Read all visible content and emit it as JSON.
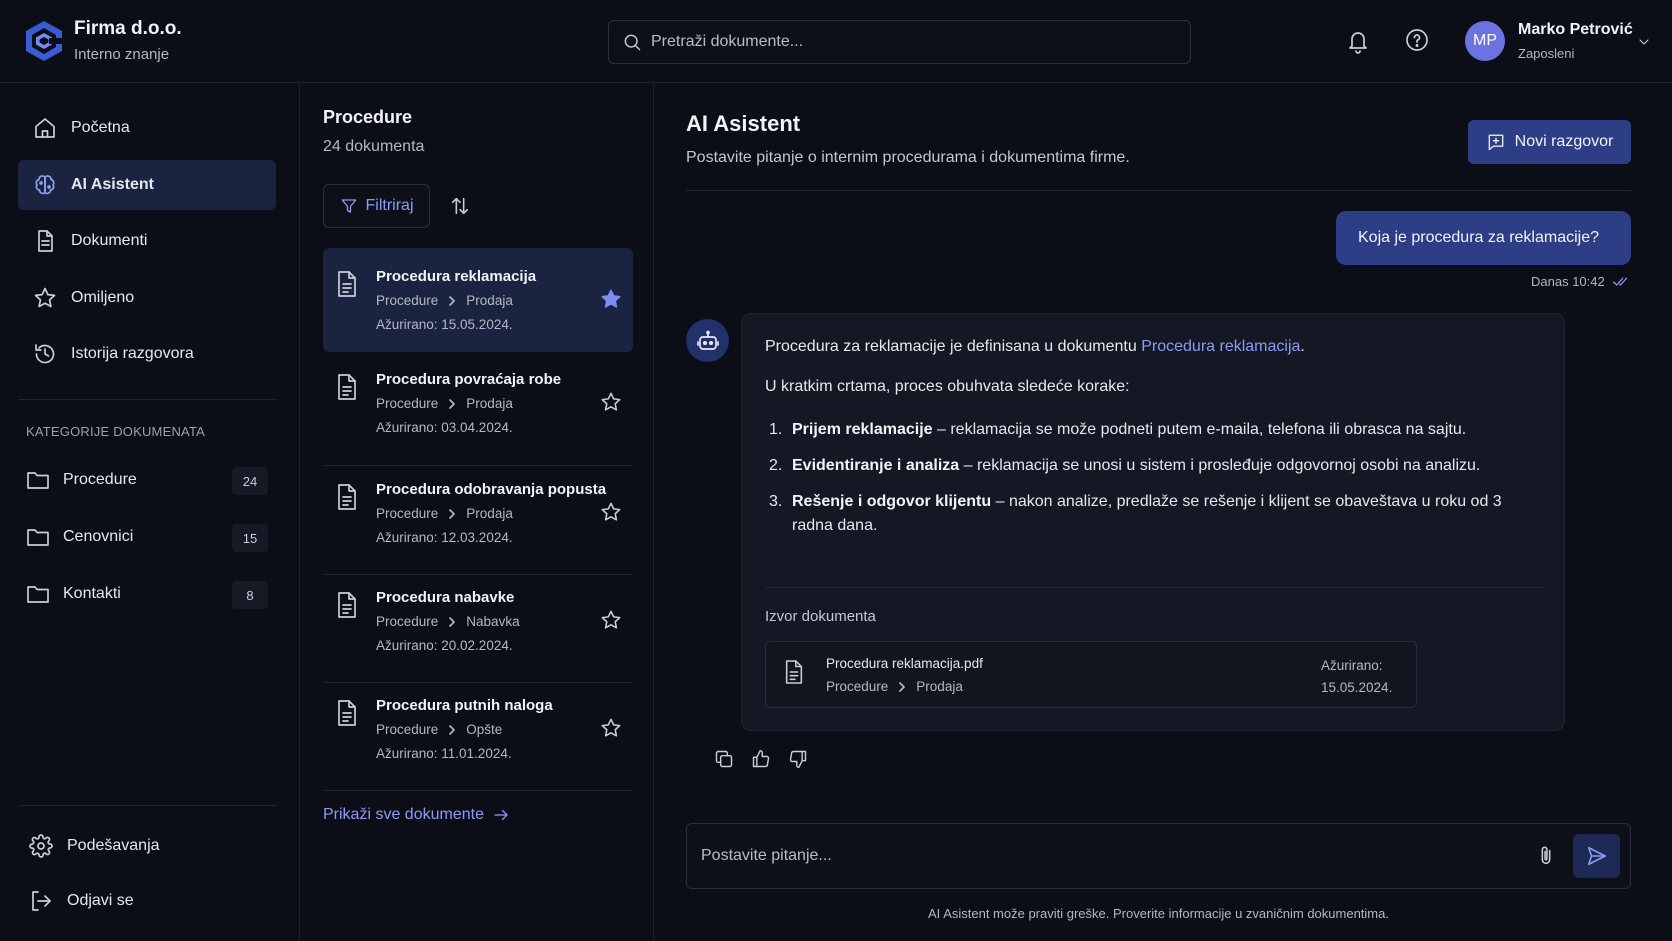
{
  "header": {
    "brand_name": "Firma d.o.o.",
    "brand_sub": "Interno znanje",
    "search_placeholder": "Pretraži dokumente...",
    "user_initials": "MP",
    "user_name": "Marko Petrović",
    "user_role": "Zaposleni"
  },
  "sidebar": {
    "nav": [
      {
        "label": "Početna",
        "icon": "home-icon"
      },
      {
        "label": "AI Asistent",
        "icon": "ai-brain-icon",
        "active": true
      },
      {
        "label": "Dokumenti",
        "icon": "document-icon"
      },
      {
        "label": "Omiljeno",
        "icon": "star-icon"
      },
      {
        "label": "Istorija razgovora",
        "icon": "history-icon"
      }
    ],
    "categories_title": "KATEGORIJE DOKUMENATA",
    "categories": [
      {
        "label": "Procedure",
        "count": "24"
      },
      {
        "label": "Cenovnici",
        "count": "15"
      },
      {
        "label": "Kontakti",
        "count": "8"
      }
    ],
    "settings_label": "Podešavanja",
    "logout_label": "Odjavi se"
  },
  "doclist": {
    "title": "Procedure",
    "count": "24 dokumenta",
    "filter_label": "Filtriraj",
    "docs": [
      {
        "title": "Procedura reklamacija",
        "path1": "Procedure",
        "path2": "Prodaja",
        "date": "Ažurirano: 15.05.2024.",
        "starred": true
      },
      {
        "title": "Procedura povraćaja robe",
        "path1": "Procedure",
        "path2": "Prodaja",
        "date": "Ažurirano: 03.04.2024.",
        "starred": false
      },
      {
        "title": "Procedura odobravanja popusta",
        "path1": "Procedure",
        "path2": "Prodaja",
        "date": "Ažurirano: 12.03.2024.",
        "starred": false
      },
      {
        "title": "Procedura nabavke",
        "path1": "Procedure",
        "path2": "Nabavka",
        "date": "Ažurirano: 20.02.2024.",
        "starred": false
      },
      {
        "title": "Procedura putnih naloga",
        "path1": "Procedure",
        "path2": "Opšte",
        "date": "Ažurirano: 11.01.2024.",
        "starred": false
      }
    ],
    "show_all_label": "Prikaži sve dokumente"
  },
  "chat": {
    "title": "AI Asistent",
    "subtitle": "Postavite pitanje o internim procedurama i dokumentima firme.",
    "new_chat_label": "Novi razgovor",
    "user_message": "Koja je procedura za reklamacije?",
    "user_message_time": "Danas 10:42",
    "bot": {
      "intro_prefix": "Procedura za reklamacije je definisana u dokumentu ",
      "intro_link": "Procedura reklamacija",
      "intro_suffix": ".",
      "lead": "U kratkim crtama, proces obuhvata sledeće korake:",
      "steps": [
        {
          "num": "1.",
          "bold": "Prijem reklamacije",
          "text": " – reklamacija se može podneti putem e-maila, telefona ili obrasca na sajtu."
        },
        {
          "num": "2.",
          "bold": "Evidentiranje i analiza",
          "text": " – reklamacija se unosi u sistem i prosleđuje odgovornoj osobi na analizu."
        },
        {
          "num": "3.",
          "bold": "Rešenje i odgovor klijentu",
          "text": " – nakon analize, predlaže se rešenje i klijent se obaveštava u roku od 3 radna dana."
        }
      ],
      "source_title": "Izvor dokumenta",
      "source_file": "Procedura reklamacija.pdf",
      "source_path1": "Procedure",
      "source_path2": "Prodaja",
      "source_updated_label": "Ažurirano:",
      "source_updated_date": "15.05.2024."
    },
    "input_placeholder": "Postavite pitanje...",
    "disclaimer": "AI Asistent može praviti greške. Proverite informacije u zvaničnim dokumentima."
  },
  "colors": {
    "background": "#0b0e16",
    "accent": "#8e9bf2",
    "active_bg": "#1a2440",
    "primary_button": "#2d3e86"
  }
}
